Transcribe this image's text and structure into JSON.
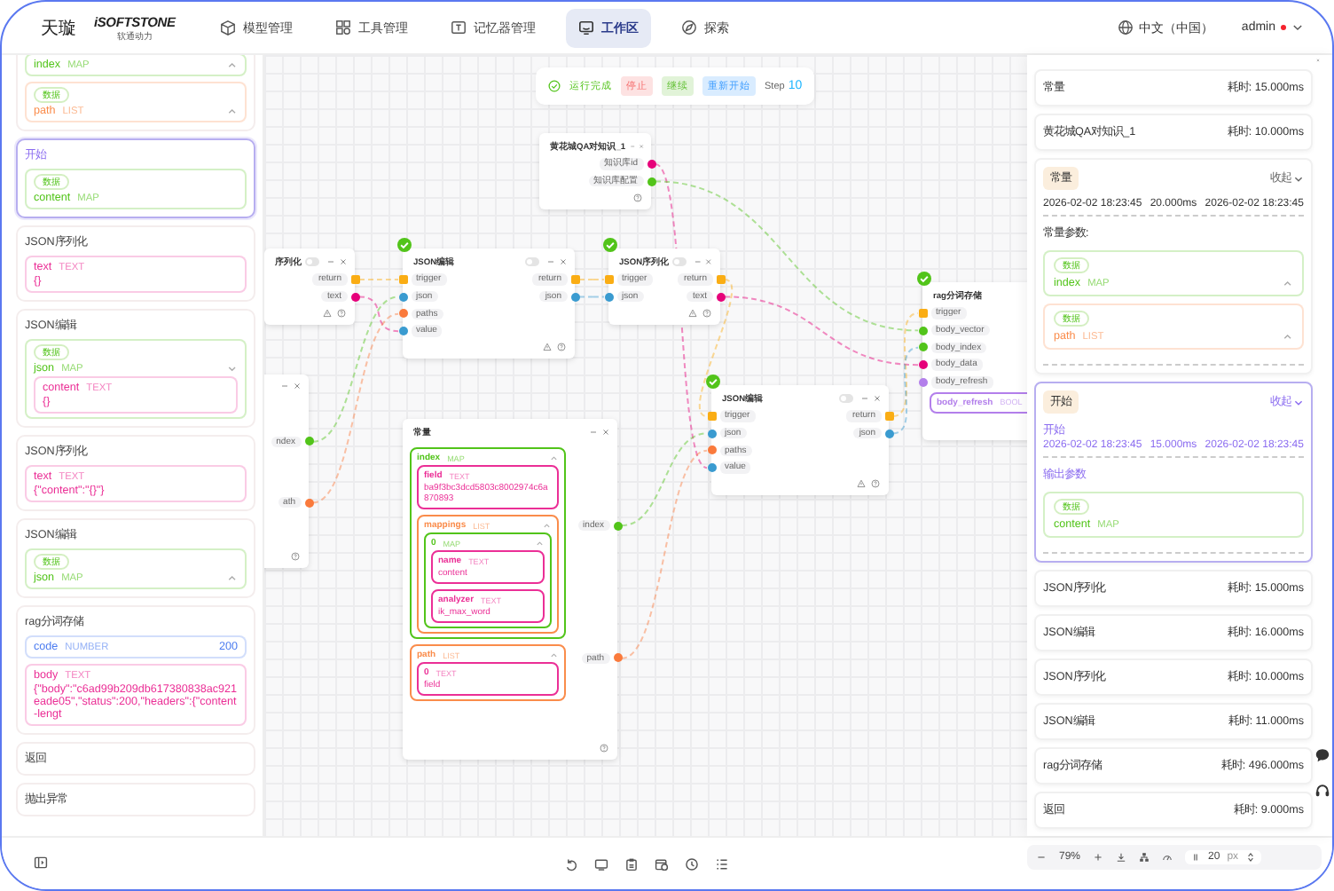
{
  "nav": {
    "brand": "天璇",
    "logo": "iSOFTSTONE",
    "logo_sub": "软通动力",
    "items": [
      {
        "label": "模型管理",
        "selected": false
      },
      {
        "label": "工具管理",
        "selected": false
      },
      {
        "label": "记忆器管理",
        "selected": false
      },
      {
        "label": "工作区",
        "selected": true
      },
      {
        "label": "探索",
        "selected": false
      }
    ],
    "language": "中文（中国）",
    "user": "admin"
  },
  "left_panel": {
    "cards": [
      {
        "selected": false,
        "params": [
          {
            "name": "index",
            "type": "MAP",
            "color": "#52c41a",
            "expanded": true
          },
          {
            "tag": "数据",
            "name": "path",
            "type": "LIST",
            "color": "#fa8c4b",
            "expanded": true
          }
        ]
      },
      {
        "selected": true,
        "title": "开始",
        "params": [
          {
            "tag": "数据",
            "name": "content",
            "type": "MAP",
            "color": "#52c41a"
          }
        ]
      },
      {
        "selected": false,
        "title": "JSON序列化",
        "params": [
          {
            "name": "text",
            "type": "TEXT",
            "color": "#eb2f96",
            "kind": "text",
            "value": "{}"
          }
        ]
      },
      {
        "selected": false,
        "title": "JSON编辑",
        "params": [
          {
            "tag": "数据",
            "name": "json",
            "type": "MAP",
            "color": "#52c41a",
            "expanded": false,
            "children": [
              {
                "name": "content",
                "type": "TEXT",
                "color": "#eb2f96",
                "kind": "text",
                "value": "{}"
              }
            ]
          }
        ]
      },
      {
        "selected": false,
        "title": "JSON序列化",
        "params": [
          {
            "name": "text",
            "type": "TEXT",
            "color": "#eb2f96",
            "kind": "text",
            "value": "{\"content\":\"{}\"}"
          }
        ]
      },
      {
        "selected": false,
        "title": "JSON编辑",
        "params": [
          {
            "tag": "数据",
            "name": "json",
            "type": "MAP",
            "color": "#52c41a",
            "expanded": true
          }
        ]
      },
      {
        "selected": false,
        "title": "rag分词存储",
        "params": [
          {
            "name": "code",
            "type": "NUMBER",
            "color": "#4c7cf0",
            "kind": "number",
            "value": "200"
          },
          {
            "name": "body",
            "type": "TEXT",
            "color": "#eb2f96",
            "kind": "text",
            "value": "{\"body\":\"c6ad99b209db617380838ac921eade05\",\"status\":200,\"headers\":{\"content-lengt"
          }
        ]
      },
      {
        "selected": false,
        "title": "返回"
      },
      {
        "selected": false,
        "title": "抛出异常"
      }
    ]
  },
  "canvas": {
    "status": {
      "label": "运行完成",
      "buttons": [
        {
          "label": "停止",
          "kind": "danger"
        },
        {
          "label": "继续",
          "kind": "success"
        },
        {
          "label": "重新开始",
          "kind": "primary"
        }
      ],
      "step_label": "Step",
      "step": "10"
    },
    "nodes": [
      {
        "kind": "tool",
        "title": "黄花城QA对知识_1",
        "done": false,
        "outputs": [
          {
            "label": "知识库id",
            "color": "#e6007a",
            "kind": "dot"
          },
          {
            "label": "知识库配置",
            "color": "#52c41a",
            "kind": "dot"
          }
        ]
      },
      {
        "kind": "tool",
        "title": "序列化",
        "done": false,
        "switch_on": false,
        "outputs": [
          {
            "label": "return",
            "color": "#faad14",
            "kind": "square"
          },
          {
            "label": "text",
            "color": "#e6007a",
            "kind": "dot"
          }
        ]
      },
      {
        "kind": "tool",
        "title": "JSON编辑",
        "done": true,
        "switch_on": false,
        "inputs": [
          {
            "label": "trigger",
            "color": "#faad14",
            "kind": "square"
          },
          {
            "label": "json",
            "color": "#3a9bd0",
            "kind": "dot"
          },
          {
            "label": "paths",
            "color": "#fa7a3c",
            "kind": "dot"
          },
          {
            "label": "value",
            "color": "#3a9bd0",
            "kind": "dot"
          }
        ],
        "outputs": [
          {
            "label": "return",
            "color": "#faad14",
            "kind": "square"
          },
          {
            "label": "json",
            "color": "#3a9bd0",
            "kind": "dot"
          }
        ]
      },
      {
        "kind": "tool",
        "title": "JSON序列化",
        "done": true,
        "switch_on": false,
        "inputs": [
          {
            "label": "trigger",
            "color": "#faad14",
            "kind": "square"
          },
          {
            "label": "json",
            "color": "#3a9bd0",
            "kind": "dot"
          }
        ],
        "outputs": [
          {
            "label": "return",
            "color": "#faad14",
            "kind": "square"
          },
          {
            "label": "text",
            "color": "#e6007a",
            "kind": "dot"
          }
        ]
      },
      {
        "kind": "tool",
        "title": "rag分词存储",
        "done": true,
        "inputs": [
          {
            "label": "trigger",
            "color": "#faad14",
            "kind": "square"
          },
          {
            "label": "body_vector",
            "color": "#52c41a",
            "kind": "dot"
          },
          {
            "label": "body_index",
            "color": "#52c41a",
            "kind": "dot"
          },
          {
            "label": "body_data",
            "color": "#e6007a",
            "kind": "dot"
          },
          {
            "label": "body_refresh",
            "color": "#b37feb",
            "kind": "dot"
          }
        ],
        "params": [
          {
            "name": "body_refresh",
            "type": "BOOL",
            "color": "#b37feb"
          }
        ]
      },
      {
        "kind": "constant",
        "done": false,
        "outputs": [
          {
            "label": "ndex",
            "color": "#52c41a",
            "kind": "dot"
          },
          {
            "label": "ath",
            "color": "#fa7a3c",
            "kind": "dot"
          }
        ]
      },
      {
        "kind": "tool",
        "title": "JSON编辑",
        "done": true,
        "switch_on": false,
        "inputs": [
          {
            "label": "trigger",
            "color": "#faad14",
            "kind": "square"
          },
          {
            "label": "json",
            "color": "#3a9bd0",
            "kind": "dot"
          },
          {
            "label": "paths",
            "color": "#fa7a3c",
            "kind": "dot"
          },
          {
            "label": "value",
            "color": "#3a9bd0",
            "kind": "dot"
          }
        ],
        "outputs": [
          {
            "label": "return",
            "color": "#faad14",
            "kind": "square"
          },
          {
            "label": "json",
            "color": "#3a9bd0",
            "kind": "dot"
          }
        ]
      },
      {
        "kind": "constant",
        "title": "常量",
        "done": false,
        "outputs": [
          {
            "label": "index",
            "color": "#52c41a",
            "kind": "dot"
          },
          {
            "label": "path",
            "color": "#fa7a3c",
            "kind": "dot"
          }
        ],
        "params": [
          {
            "name": "index",
            "type": "MAP",
            "color": "#52c41a",
            "expanded": true,
            "children": [
              {
                "name": "field",
                "type": "TEXT",
                "color": "#eb2f96",
                "kind": "text",
                "value": "ba9f3bc3dcd5803c8002974c6a870893"
              },
              {
                "name": "mappings",
                "type": "LIST",
                "color": "#fa8c4b",
                "expanded": true,
                "children": [
                  {
                    "name": "0",
                    "type": "MAP",
                    "color": "#52c41a",
                    "expanded": true,
                    "children": [
                      {
                        "name": "name",
                        "type": "TEXT",
                        "color": "#eb2f96",
                        "kind": "text",
                        "value": "content"
                      },
                      {
                        "name": "analyzer",
                        "type": "TEXT",
                        "color": "#eb2f96",
                        "kind": "text",
                        "value": "ik_max_word"
                      }
                    ]
                  }
                ]
              }
            ]
          },
          {
            "name": "path",
            "type": "LIST",
            "color": "#fa8c4b",
            "expanded": true,
            "children": [
              {
                "name": "0",
                "type": "TEXT",
                "color": "#eb2f96",
                "kind": "text",
                "value": "field"
              }
            ]
          }
        ]
      }
    ]
  },
  "run_panel": {
    "items": [
      {
        "kind": "row",
        "title": "常量",
        "time": "耗时: 15.000ms"
      },
      {
        "kind": "row",
        "title": "黄花城QA对知识_1",
        "time": "耗时: 10.000ms"
      },
      {
        "kind": "detail",
        "selected": false,
        "tag": "常量",
        "toggle": "收起",
        "start": "2026-02-02 18:23:45",
        "duration": "20.000ms",
        "end": "2026-02-02 18:23:45",
        "section": "常量参数:",
        "params": [
          {
            "tag": "数据",
            "name": "index",
            "type": "MAP",
            "color": "#52c41a",
            "expanded": true
          },
          {
            "tag": "数据",
            "name": "path",
            "type": "LIST",
            "color": "#fa8c4b",
            "expanded": true
          }
        ]
      },
      {
        "kind": "detail",
        "selected": true,
        "tag": "开始",
        "toggle": "收起",
        "name": "开始",
        "start": "2026-02-02 18:23:45",
        "duration": "15.000ms",
        "end": "2026-02-02 18:23:45",
        "section": "输出参数",
        "params": [
          {
            "tag": "数据",
            "name": "content",
            "type": "MAP",
            "color": "#52c41a"
          }
        ]
      },
      {
        "kind": "row",
        "title": "JSON序列化",
        "time": "耗时: 15.000ms"
      },
      {
        "kind": "row",
        "title": "JSON编辑",
        "time": "耗时: 16.000ms"
      },
      {
        "kind": "row",
        "title": "JSON序列化",
        "time": "耗时: 10.000ms"
      },
      {
        "kind": "row",
        "title": "JSON编辑",
        "time": "耗时: 11.000ms"
      },
      {
        "kind": "row",
        "title": "rag分词存储",
        "time": "耗时: 496.000ms"
      },
      {
        "kind": "row",
        "title": "返回",
        "time": "耗时: 9.000ms"
      }
    ]
  },
  "bottom_bar": {
    "zoom": "79%",
    "grid_size": "20",
    "grid_unit": "px"
  }
}
